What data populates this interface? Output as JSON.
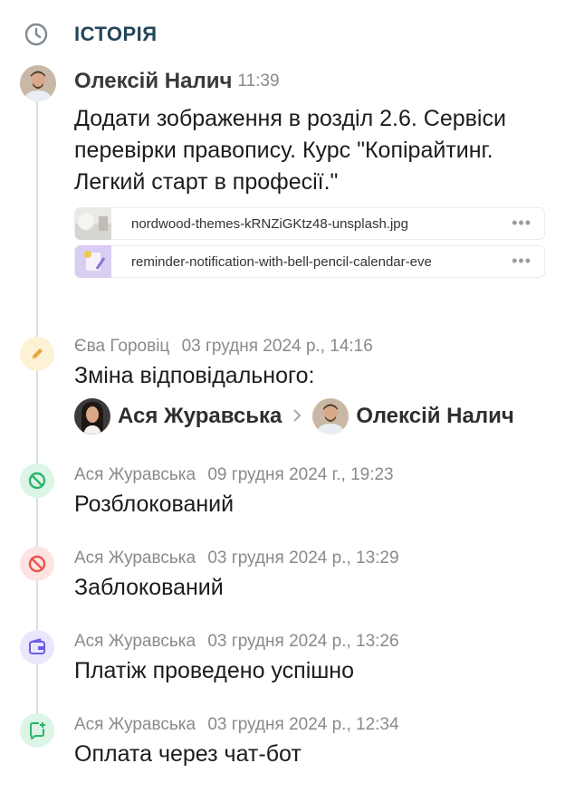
{
  "header": {
    "title": "ІСТОРІЯ",
    "icon": "clock-icon"
  },
  "entries": {
    "comment": {
      "author": "Олексій Налич",
      "time": "11:39",
      "text": "Додати зображення в розділ 2.6. Сервіси перевірки правопису. Курс \"Копірайтинг. Легкий старт в професії.\"",
      "files": [
        {
          "name": "nordwood-themes-kRNZiGKtz48-unsplash.jpg",
          "more": "•••"
        },
        {
          "name": "reminder-notification-with-bell-pencil-calendar-eve",
          "more": "•••"
        }
      ]
    },
    "assign": {
      "icon": "pencil-icon",
      "author": "Єва Горовіц",
      "date": "03 грудня 2024 р., 14:16",
      "text": "Зміна відповідального:",
      "from": "Ася Журавська",
      "to": "Олексій Налич"
    },
    "unblocked": {
      "icon": "unblock-icon",
      "author": "Ася Журавська",
      "date": "09 грудня 2024 г., 19:23",
      "text": "Розблокований"
    },
    "blocked": {
      "icon": "block-icon",
      "author": "Ася Журавська",
      "date": "03 грудня 2024 р., 13:29",
      "text": "Заблокований"
    },
    "payment": {
      "icon": "wallet-icon",
      "author": "Ася Журавська",
      "date": "03 грудня 2024 р., 13:26",
      "text": "Платіж проведено успішно"
    },
    "chatbot": {
      "icon": "chat-add-icon",
      "author": "Ася Журавська",
      "date": "03 грудня 2024 р., 12:34",
      "text": "Оплата через чат-бот"
    }
  },
  "colors": {
    "title": "#22465a",
    "timeline": "#cfe3e0",
    "pencil_bg": "#fdf1d6",
    "pencil": "#e7a63a",
    "unblock_bg": "#dcf5e6",
    "unblock": "#2fb46a",
    "block_bg": "#fde3e1",
    "block": "#e8544a",
    "wallet_bg": "#e9e7fb",
    "wallet": "#6c5ce7",
    "chat_bg": "#dcf5e6",
    "chat": "#2fb46a"
  }
}
